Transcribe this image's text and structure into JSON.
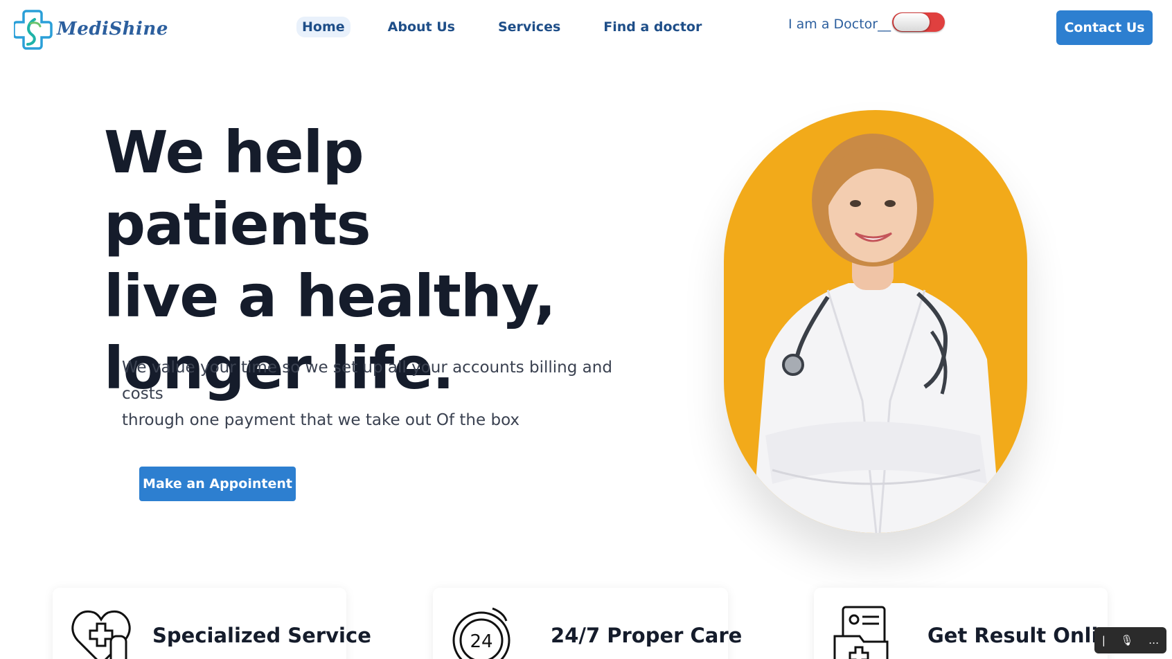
{
  "brand": {
    "name": "MediShine"
  },
  "nav": {
    "items": [
      {
        "label": "Home",
        "active": true
      },
      {
        "label": "About Us",
        "active": false
      },
      {
        "label": "Services",
        "active": false
      },
      {
        "label": "Find a doctor",
        "active": false
      }
    ]
  },
  "doctor_toggle": {
    "label": "I am a Doctor__",
    "state": "off"
  },
  "header": {
    "contact_label": "Contact Us"
  },
  "hero": {
    "title_line1": "We help patients",
    "title_line2": "live a healthy,",
    "title_line3": "longer life.",
    "subtitle_line1": "We value your time so we set up all your accounts billing and costs",
    "subtitle_line2": "through one payment that we take out Of the box",
    "cta_label": "Make an Appointent",
    "image_alt": "doctor-photo"
  },
  "features": [
    {
      "title": "Specialized Service",
      "icon": "heart-medical-icon"
    },
    {
      "title": "24/7 Proper Care",
      "icon": "clock-24-icon"
    },
    {
      "title": "Get Result Online",
      "icon": "medical-report-icon"
    }
  ],
  "colors": {
    "primary": "#2d7fd0",
    "nav_text": "#1e4e88",
    "heading": "#151c2b",
    "hero_bg": "#f2aa1a",
    "toggle_off": "#e0403f"
  }
}
